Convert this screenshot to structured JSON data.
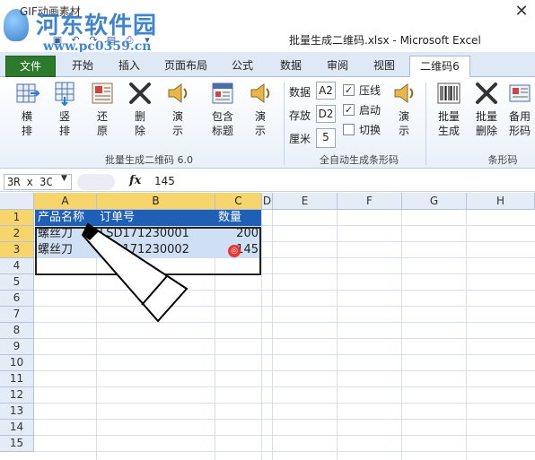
{
  "titlebar": {
    "secondary_title": "GIF动画素材",
    "document_title": "批量生成二维码.xlsx  -  Microsoft Excel",
    "close_glyph": "✕",
    "watermark_text": "河东软件园",
    "watermark_url": "www.pc0359.cn"
  },
  "tabs": [
    {
      "label": "文件"
    },
    {
      "label": "开始"
    },
    {
      "label": "插入"
    },
    {
      "label": "页面布局"
    },
    {
      "label": "公式"
    },
    {
      "label": "数据"
    },
    {
      "label": "审阅"
    },
    {
      "label": "视图"
    },
    {
      "label": "二维码6"
    }
  ],
  "ribbon": {
    "buttons": [
      {
        "l1": "横",
        "l2": "排"
      },
      {
        "l1": "竖",
        "l2": "排"
      },
      {
        "l1": "还",
        "l2": "原"
      },
      {
        "l1": "删",
        "l2": "除"
      },
      {
        "l1": "演",
        "l2": "示"
      },
      {
        "l1": "包含",
        "l2": "标题"
      },
      {
        "l1": "演",
        "l2": "示"
      },
      {
        "l1": "演",
        "l2": "示"
      },
      {
        "l1": "批量",
        "l2": "生成"
      },
      {
        "l1": "批量",
        "l2": "删除"
      },
      {
        "l1": "备用",
        "l2": "形码"
      }
    ],
    "fields": {
      "data_label": "数据",
      "data_value": "A2",
      "store_label": "存放",
      "store_value": "D2",
      "cm_label": "厘米",
      "cm_value": "5"
    },
    "checks": [
      {
        "label": "压线",
        "checked": "✓"
      },
      {
        "label": "启动",
        "checked": "✓"
      },
      {
        "label": "切换",
        "checked": ""
      }
    ],
    "groups": [
      "批量生成二维码 6.0",
      "全自动生成条形码",
      "条形码"
    ]
  },
  "formula_bar": {
    "name_box": "3R x 3C",
    "fx": "fx",
    "value": "145"
  },
  "grid": {
    "columns": [
      "A",
      "B",
      "C",
      "D",
      "E",
      "F",
      "G",
      "H"
    ],
    "rows": [
      "1",
      "2",
      "3",
      "4",
      "5",
      "6",
      "7",
      "8",
      "9",
      "10",
      "11",
      "12",
      "13",
      "14",
      "15"
    ],
    "header_row": [
      "产品名称",
      "订单号",
      "数量"
    ],
    "data": [
      [
        "螺丝刀",
        "LSD171230001",
        "200"
      ],
      [
        "螺丝刀",
        "LSD171230002",
        "145"
      ]
    ]
  }
}
